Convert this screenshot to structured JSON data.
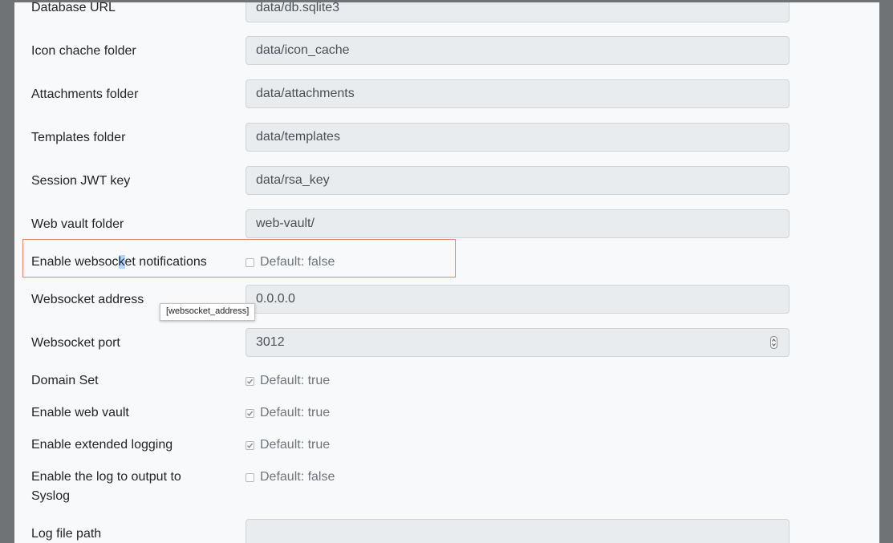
{
  "fields": {
    "database_url": {
      "label": "Database URL",
      "value": "data/db.sqlite3"
    },
    "icon_cache_folder": {
      "label": "Icon chache folder",
      "value": "data/icon_cache"
    },
    "attachments_folder": {
      "label": "Attachments folder",
      "value": "data/attachments"
    },
    "templates_folder": {
      "label": "Templates folder",
      "value": "data/templates"
    },
    "session_jwt_key": {
      "label": "Session JWT key",
      "value": "data/rsa_key"
    },
    "web_vault_folder": {
      "label": "Web vault folder",
      "value": "web-vault/"
    },
    "websocket_enabled": {
      "label_before": "Enable websoc",
      "label_selected": "k",
      "label_after": "et notifications",
      "default_text": "Default: false",
      "checked": false
    },
    "websocket_address": {
      "label": "Websocket address",
      "value": "0.0.0.0"
    },
    "websocket_port": {
      "label": "Websocket port",
      "value": "3012"
    },
    "domain_set": {
      "label": "Domain Set",
      "default_text": "Default: true",
      "checked": true
    },
    "web_vault_enabled": {
      "label": "Enable web vault",
      "default_text": "Default: true",
      "checked": true
    },
    "extended_logging": {
      "label": "Enable extended logging",
      "default_text": "Default: true",
      "checked": true
    },
    "use_syslog": {
      "label": "Enable the log to output to Syslog",
      "default_text": "Default: false",
      "checked": false
    },
    "log_file": {
      "label": "Log file path",
      "value": ""
    }
  },
  "tooltip": {
    "text": "[websocket_address]"
  },
  "colors": {
    "highlight_border": "#e8816f",
    "text_selection": "#b3d4fd",
    "input_bg": "#e9ecef",
    "panel_bg": "#f8f9fa",
    "frame_bg": "#6f7375"
  },
  "icons": {
    "checkmark": "check-icon",
    "number_spinner": "spinner-arrows-icon"
  }
}
